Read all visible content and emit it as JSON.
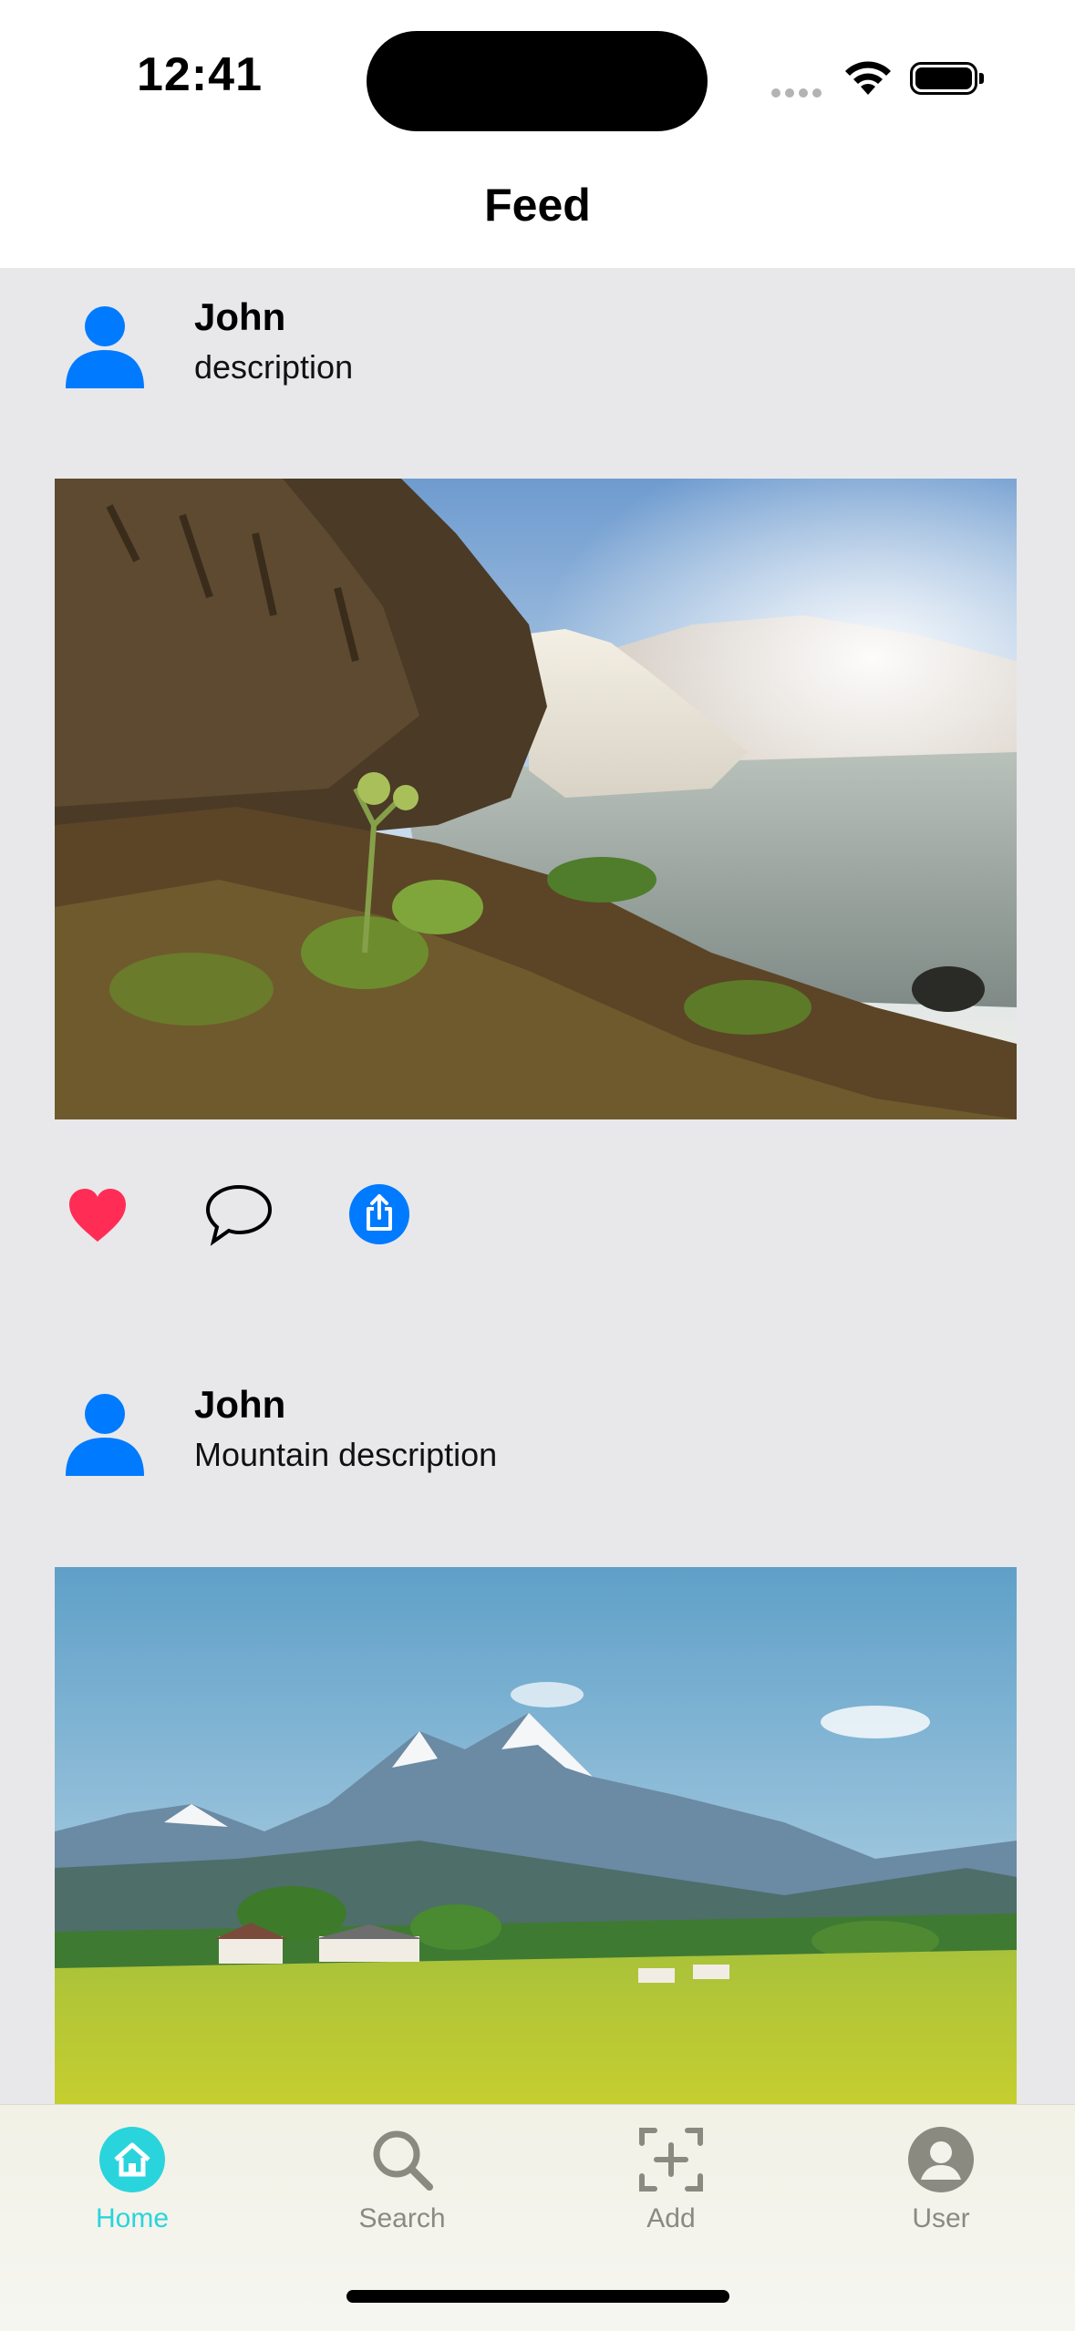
{
  "status_bar": {
    "time": "12:41"
  },
  "nav": {
    "title": "Feed"
  },
  "posts": [
    {
      "user": "John",
      "description": "description",
      "image": "waterfall-landscape",
      "liked": true
    },
    {
      "user": "John",
      "description": "Mountain description",
      "image": "mountain-meadow-landscape",
      "liked": false
    }
  ],
  "tabs": [
    {
      "label": "Home",
      "icon": "home-icon",
      "active": true
    },
    {
      "label": "Search",
      "icon": "search-icon",
      "active": false
    },
    {
      "label": "Add",
      "icon": "add-icon",
      "active": false
    },
    {
      "label": "User",
      "icon": "user-icon",
      "active": false
    }
  ],
  "colors": {
    "accent": "#2ad4dc",
    "avatar_blue": "#007aff",
    "heart": "#ff2d55",
    "feed_bg": "#e8e8ea"
  }
}
